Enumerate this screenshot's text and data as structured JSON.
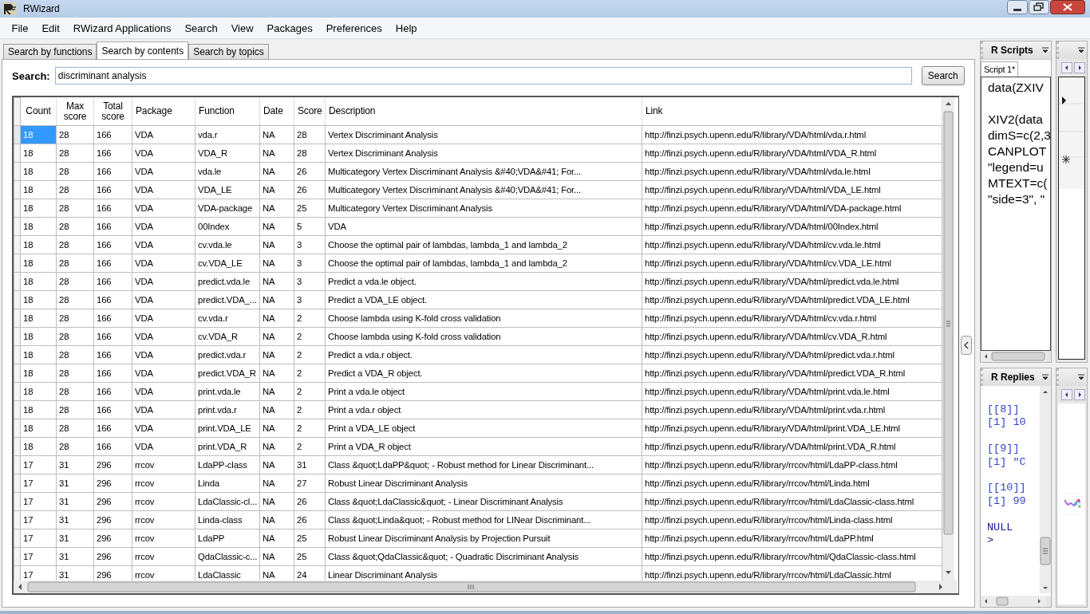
{
  "window": {
    "title": "RWizard"
  },
  "menu": [
    "File",
    "Edit",
    "RWizard Applications",
    "Search",
    "View",
    "Packages",
    "Preferences",
    "Help"
  ],
  "tabs": [
    {
      "label": "Search by functions",
      "selected": false
    },
    {
      "label": "Search by contents",
      "selected": true
    },
    {
      "label": "Search by topics",
      "selected": false
    }
  ],
  "search": {
    "label": "Search:",
    "value": "discriminant analysis",
    "button": "Search"
  },
  "table": {
    "columns": [
      "Count",
      "Max score",
      "Total score",
      "Package",
      "Function",
      "Date",
      "Score",
      "Description",
      "Link"
    ],
    "rows": [
      {
        "selected": true,
        "cells": [
          "18",
          "28",
          "166",
          "VDA",
          "vda.r",
          "NA",
          "28",
          "Vertex Discriminant Analysis",
          "http://finzi.psych.upenn.edu/R/library/VDA/html/vda.r.html"
        ]
      },
      {
        "selected": false,
        "cells": [
          "18",
          "28",
          "166",
          "VDA",
          "VDA_R",
          "NA",
          "28",
          "Vertex Discriminant Analysis",
          "http://finzi.psych.upenn.edu/R/library/VDA/html/VDA_R.html"
        ]
      },
      {
        "selected": false,
        "cells": [
          "18",
          "28",
          "166",
          "VDA",
          "vda.le",
          "NA",
          "26",
          "Multicategory Vertex Discriminant Analysis &#40;VDA&#41; For...",
          "http://finzi.psych.upenn.edu/R/library/VDA/html/vda.le.html"
        ]
      },
      {
        "selected": false,
        "cells": [
          "18",
          "28",
          "166",
          "VDA",
          "VDA_LE",
          "NA",
          "26",
          "Multicategory Vertex Discriminant Analysis &#40;VDA&#41; For...",
          "http://finzi.psych.upenn.edu/R/library/VDA/html/VDA_LE.html"
        ]
      },
      {
        "selected": false,
        "cells": [
          "18",
          "28",
          "166",
          "VDA",
          "VDA-package",
          "NA",
          "25",
          "Multicategory Vertex Discriminant Analysis",
          "http://finzi.psych.upenn.edu/R/library/VDA/html/VDA-package.html"
        ]
      },
      {
        "selected": false,
        "cells": [
          "18",
          "28",
          "166",
          "VDA",
          "00Index",
          "NA",
          "5",
          "VDA",
          "http://finzi.psych.upenn.edu/R/library/VDA/html/00Index.html"
        ]
      },
      {
        "selected": false,
        "cells": [
          "18",
          "28",
          "166",
          "VDA",
          "cv.vda.le",
          "NA",
          "3",
          "Choose the optimal pair of lambdas, lambda_1 and lambda_2",
          "http://finzi.psych.upenn.edu/R/library/VDA/html/cv.vda.le.html"
        ]
      },
      {
        "selected": false,
        "cells": [
          "18",
          "28",
          "166",
          "VDA",
          "cv.VDA_LE",
          "NA",
          "3",
          "Choose the optimal pair of lambdas, lambda_1 and lambda_2",
          "http://finzi.psych.upenn.edu/R/library/VDA/html/cv.VDA_LE.html"
        ]
      },
      {
        "selected": false,
        "cells": [
          "18",
          "28",
          "166",
          "VDA",
          "predict.vda.le",
          "NA",
          "3",
          "Predict a vda.le object.",
          "http://finzi.psych.upenn.edu/R/library/VDA/html/predict.vda.le.html"
        ]
      },
      {
        "selected": false,
        "cells": [
          "18",
          "28",
          "166",
          "VDA",
          "predict.VDA_...",
          "NA",
          "3",
          "Predict a VDA_LE object.",
          "http://finzi.psych.upenn.edu/R/library/VDA/html/predict.VDA_LE.html"
        ]
      },
      {
        "selected": false,
        "cells": [
          "18",
          "28",
          "166",
          "VDA",
          "cv.vda.r",
          "NA",
          "2",
          "Choose lambda using K-fold cross validation",
          "http://finzi.psych.upenn.edu/R/library/VDA/html/cv.vda.r.html"
        ]
      },
      {
        "selected": false,
        "cells": [
          "18",
          "28",
          "166",
          "VDA",
          "cv.VDA_R",
          "NA",
          "2",
          "Choose lambda using K-fold cross validation",
          "http://finzi.psych.upenn.edu/R/library/VDA/html/cv.VDA_R.html"
        ]
      },
      {
        "selected": false,
        "cells": [
          "18",
          "28",
          "166",
          "VDA",
          "predict.vda.r",
          "NA",
          "2",
          "Predict a vda.r object.",
          "http://finzi.psych.upenn.edu/R/library/VDA/html/predict.vda.r.html"
        ]
      },
      {
        "selected": false,
        "cells": [
          "18",
          "28",
          "166",
          "VDA",
          "predict.VDA_R",
          "NA",
          "2",
          "Predict a VDA_R object.",
          "http://finzi.psych.upenn.edu/R/library/VDA/html/predict.VDA_R.html"
        ]
      },
      {
        "selected": false,
        "cells": [
          "18",
          "28",
          "166",
          "VDA",
          "print.vda.le",
          "NA",
          "2",
          "Print a vda.le object",
          "http://finzi.psych.upenn.edu/R/library/VDA/html/print.vda.le.html"
        ]
      },
      {
        "selected": false,
        "cells": [
          "18",
          "28",
          "166",
          "VDA",
          "print.vda.r",
          "NA",
          "2",
          "Print a vda.r object",
          "http://finzi.psych.upenn.edu/R/library/VDA/html/print.vda.r.html"
        ]
      },
      {
        "selected": false,
        "cells": [
          "18",
          "28",
          "166",
          "VDA",
          "print.VDA_LE",
          "NA",
          "2",
          "Print a VDA_LE object",
          "http://finzi.psych.upenn.edu/R/library/VDA/html/print.VDA_LE.html"
        ]
      },
      {
        "selected": false,
        "cells": [
          "18",
          "28",
          "166",
          "VDA",
          "print.VDA_R",
          "NA",
          "2",
          "Print a VDA_R object",
          "http://finzi.psych.upenn.edu/R/library/VDA/html/print.VDA_R.html"
        ]
      },
      {
        "selected": false,
        "cells": [
          "17",
          "31",
          "296",
          "rrcov",
          "LdaPP-class",
          "NA",
          "31",
          "Class &quot;LdaPP&quot; - Robust method for Linear Discriminant...",
          "http://finzi.psych.upenn.edu/R/library/rrcov/html/LdaPP-class.html"
        ]
      },
      {
        "selected": false,
        "cells": [
          "17",
          "31",
          "296",
          "rrcov",
          "Linda",
          "NA",
          "27",
          "Robust Linear Discriminant Analysis",
          "http://finzi.psych.upenn.edu/R/library/rrcov/html/Linda.html"
        ]
      },
      {
        "selected": false,
        "cells": [
          "17",
          "31",
          "296",
          "rrcov",
          "LdaClassic-cl...",
          "NA",
          "26",
          "Class &quot;LdaClassic&quot; - Linear Discriminant Analysis",
          "http://finzi.psych.upenn.edu/R/library/rrcov/html/LdaClassic-class.html"
        ]
      },
      {
        "selected": false,
        "cells": [
          "17",
          "31",
          "296",
          "rrcov",
          "Linda-class",
          "NA",
          "26",
          "Class &quot;Linda&quot; - Robust method for LINear Discriminant...",
          "http://finzi.psych.upenn.edu/R/library/rrcov/html/Linda-class.html"
        ]
      },
      {
        "selected": false,
        "cells": [
          "17",
          "31",
          "296",
          "rrcov",
          "LdaPP",
          "NA",
          "25",
          "Robust Linear Discriminant Analysis by Projection Pursuit",
          "http://finzi.psych.upenn.edu/R/library/rrcov/html/LdaPP.html"
        ]
      },
      {
        "selected": false,
        "cells": [
          "17",
          "31",
          "296",
          "rrcov",
          "QdaClassic-c...",
          "NA",
          "25",
          "Class &quot;QdaClassic&quot; - Quadratic Discriminant Analysis",
          "http://finzi.psych.upenn.edu/R/library/rrcov/html/QdaClassic-class.html"
        ]
      },
      {
        "selected": false,
        "cells": [
          "17",
          "31",
          "296",
          "rrcov",
          "LdaClassic",
          "NA",
          "24",
          "Linear Discriminant Analysis",
          "http://finzi.psych.upenn.edu/R/library/rrcov/html/LdaClassic.html"
        ]
      }
    ]
  },
  "scripts_panel": {
    "title": "R Scripts",
    "tab": "Script 1*",
    "blocks": [
      [
        "data(ZXIV"
      ],
      [
        "XIV2(data",
        "dimS=c(2,3",
        "CANPLOT",
        "\"legend=u",
        "MTEXT=c(",
        "\"side=3\", \""
      ]
    ]
  },
  "replies_panel": {
    "title": "R Replies",
    "blocks": [
      [
        "[[8]]",
        "[1] 10"
      ],
      [
        "[[9]]",
        "[1] \"C"
      ],
      [
        "[[10]]",
        "[1] 99"
      ],
      [
        "NULL",
        ">"
      ]
    ]
  }
}
